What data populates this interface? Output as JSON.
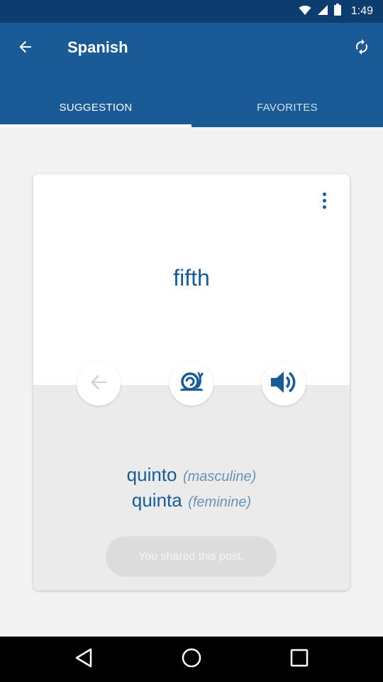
{
  "status_bar": {
    "time": "1:49"
  },
  "app_bar": {
    "title": "Spanish"
  },
  "tabs": [
    {
      "label": "SUGGESTION",
      "active": true
    },
    {
      "label": "FAVORITES",
      "active": false
    }
  ],
  "card": {
    "word": "fifth",
    "translations": [
      {
        "word": "quinto",
        "gender": "(masculine)"
      },
      {
        "word": "quinta",
        "gender": "(feminine)"
      }
    ],
    "shared_label": "You shared this post."
  },
  "colors": {
    "app_bar": "#1a5b96",
    "status_bar": "#0d3d6e",
    "accent_text": "#1a5b96",
    "gender_text": "#6a92b8"
  },
  "icons": [
    "arrow-back-icon",
    "refresh-icon",
    "more-vert-icon",
    "arrow-left-icon",
    "snail-icon",
    "volume-icon",
    "nav-back-icon",
    "nav-home-icon",
    "nav-recent-icon",
    "wifi-icon",
    "signal-icon",
    "battery-icon"
  ]
}
